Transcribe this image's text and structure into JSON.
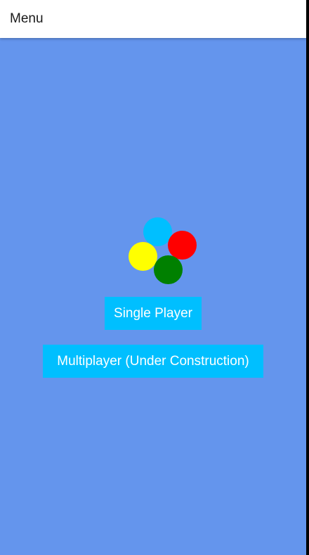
{
  "appbar": {
    "title": "Menu"
  },
  "logo": {
    "dots": [
      {
        "name": "blue-dot",
        "color": "#00BFFF"
      },
      {
        "name": "red-dot",
        "color": "#FF0000"
      },
      {
        "name": "yellow-dot",
        "color": "#FFFF00"
      },
      {
        "name": "green-dot",
        "color": "#008000"
      }
    ]
  },
  "menu": {
    "single_player_label": "Single Player",
    "multiplayer_label": "Multiplayer (Under Construction)"
  },
  "colors": {
    "background": "#6495ED",
    "appbar": "#FFFFFF",
    "button": "#00BFFF",
    "button_text": "#FFFFFF"
  }
}
